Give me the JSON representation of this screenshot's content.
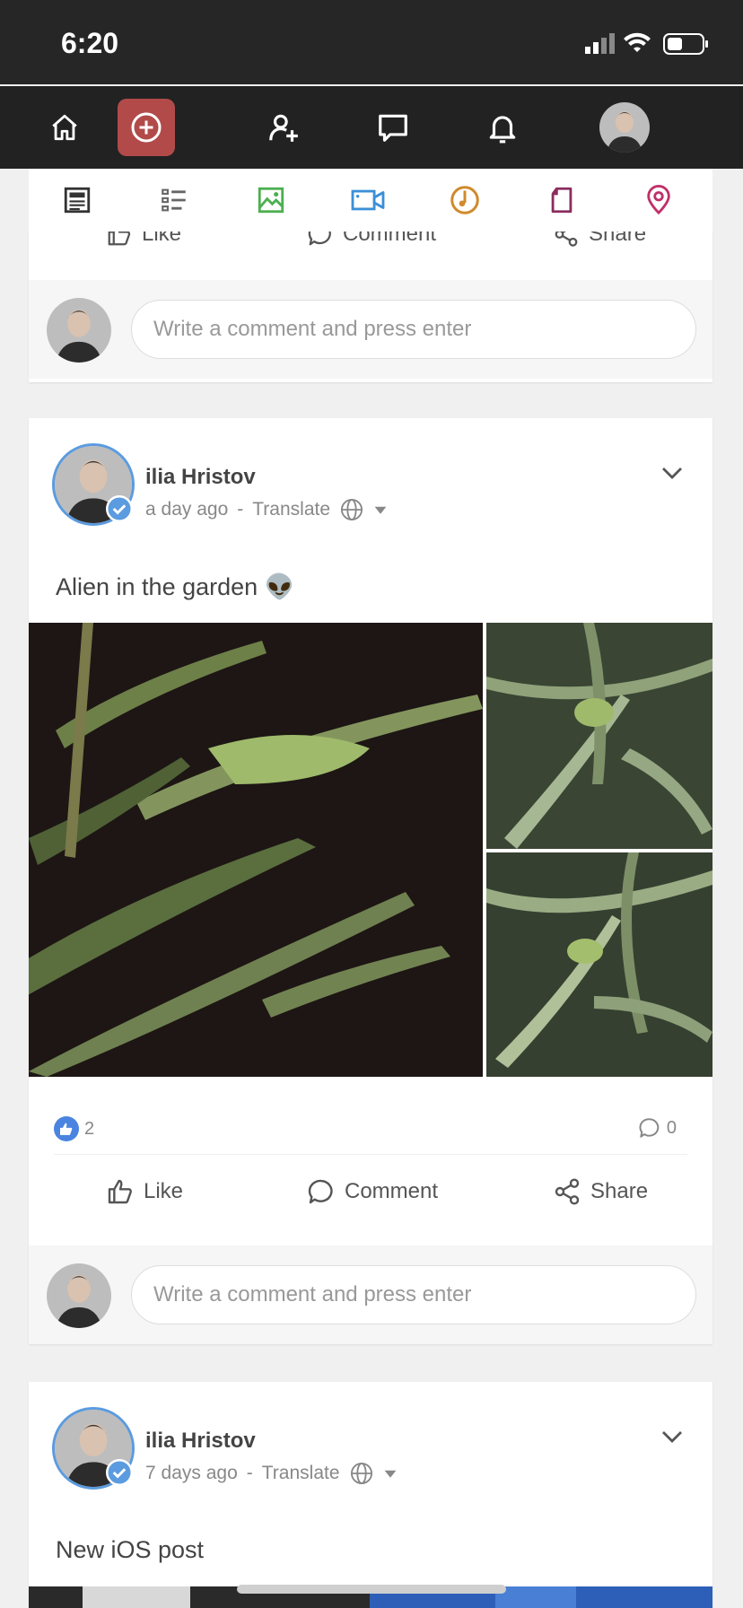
{
  "status_bar": {
    "time": "6:20"
  },
  "nav": {
    "items": [
      "home-icon",
      "add-post-icon",
      "add-friend-icon",
      "messages-icon",
      "notifications-icon",
      "profile-avatar"
    ],
    "accent": "#b24a4a"
  },
  "subtabs": {
    "items": [
      "news-feed-icon",
      "list-icon",
      "photos-icon",
      "videos-icon",
      "music-icon",
      "files-icon",
      "places-icon"
    ],
    "colors": [
      "#333333",
      "#555555",
      "#4caf50",
      "#3b8fd8",
      "#d08a2c",
      "#8a2d5e",
      "#c0306a"
    ]
  },
  "prev_post": {
    "like_label": "Like",
    "comment_label": "Comment",
    "share_label": "Share",
    "comment_placeholder": "Write a comment and press enter"
  },
  "posts": [
    {
      "author": "ilia Hristov",
      "time": "a day ago",
      "translate": "Translate",
      "text": "Alien in the garden 👽",
      "likes": "2",
      "comments": "0",
      "like_label": "Like",
      "comment_label": "Comment",
      "share_label": "Share",
      "comment_placeholder": "Write a comment and press enter"
    },
    {
      "author": "ilia Hristov",
      "time": "7 days ago",
      "translate": "Translate",
      "text": "New iOS post"
    }
  ]
}
